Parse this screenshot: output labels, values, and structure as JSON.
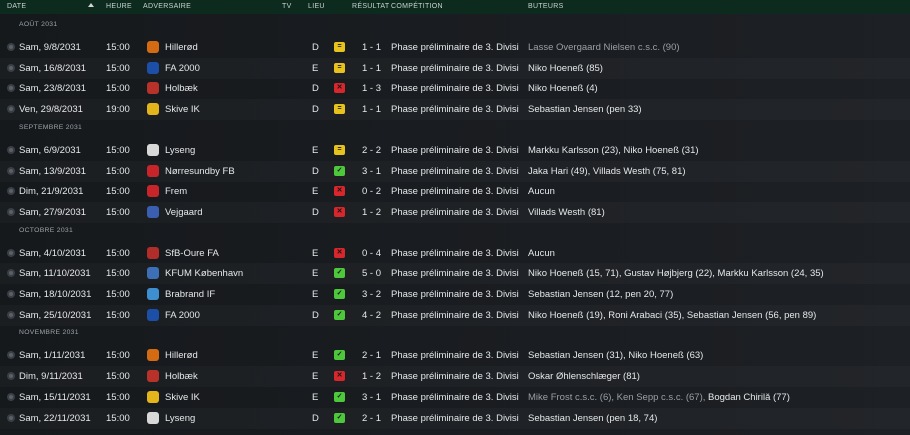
{
  "header": {
    "date": "DATE",
    "time": "HEURE",
    "opponent": "ADVERSAIRE",
    "tv": "TV",
    "venue": "LIEU",
    "result": "RÉSULTAT",
    "competition": "COMPÉTITION",
    "scorers": "BUTEURS"
  },
  "groups": [
    "AOÛT 2031",
    "SEPTEMBRE 2031",
    "OCTOBRE 2031",
    "NOVEMBRE 2031"
  ],
  "status_colors": {
    "draw": "#e8c21c",
    "loss": "#d7262c",
    "win": "#4cc83a"
  },
  "matches": [
    {
      "date": "Sam, 9/8/2031",
      "time": "15:00",
      "opponent": "Hillerød",
      "venue": "D",
      "result": "draw",
      "score": "1 - 1",
      "competition": "Phase préliminaire de 3. Divisi",
      "scorers_dim": "Lasse Overgaard Nielsen c.s.c. (90)",
      "scorers": ""
    },
    {
      "date": "Sam, 16/8/2031",
      "time": "15:00",
      "opponent": "FA 2000",
      "venue": "E",
      "result": "draw",
      "score": "1 - 1",
      "competition": "Phase préliminaire de 3. Divisi",
      "scorers_dim": "",
      "scorers": "Niko Hoeneß (85)"
    },
    {
      "date": "Sam, 23/8/2031",
      "time": "15:00",
      "opponent": "Holbæk",
      "venue": "D",
      "result": "loss",
      "score": "1 - 3",
      "competition": "Phase préliminaire de 3. Divisi",
      "scorers_dim": "",
      "scorers": "Niko Hoeneß (4)"
    },
    {
      "date": "Ven, 29/8/2031",
      "time": "19:00",
      "opponent": "Skive IK",
      "venue": "D",
      "result": "draw",
      "score": "1 - 1",
      "competition": "Phase préliminaire de 3. Divisi",
      "scorers_dim": "",
      "scorers": "Sebastian Jensen (pen 33)"
    },
    {
      "date": "Sam, 6/9/2031",
      "time": "15:00",
      "opponent": "Lyseng",
      "venue": "E",
      "result": "draw",
      "score": "2 - 2",
      "competition": "Phase préliminaire de 3. Divisi",
      "scorers_dim": "",
      "scorers": "Markku Karlsson (23), Niko Hoeneß (31)"
    },
    {
      "date": "Sam, 13/9/2031",
      "time": "15:00",
      "opponent": "Nørresundby FB",
      "venue": "D",
      "result": "win",
      "score": "3 - 1",
      "competition": "Phase préliminaire de 3. Divisi",
      "scorers_dim": "",
      "scorers": "Jaka Hari (49), Villads Westh (75, 81)"
    },
    {
      "date": "Dim, 21/9/2031",
      "time": "15:00",
      "opponent": "Frem",
      "venue": "E",
      "result": "loss",
      "score": "0 - 2",
      "competition": "Phase préliminaire de 3. Divisi",
      "scorers_dim": "",
      "scorers": "Aucun"
    },
    {
      "date": "Sam, 27/9/2031",
      "time": "15:00",
      "opponent": "Vejgaard",
      "venue": "D",
      "result": "loss",
      "score": "1 - 2",
      "competition": "Phase préliminaire de 3. Divisi",
      "scorers_dim": "",
      "scorers": "Villads Westh (81)"
    },
    {
      "date": "Sam, 4/10/2031",
      "time": "15:00",
      "opponent": "SfB-Oure FA",
      "venue": "E",
      "result": "loss",
      "score": "0 - 4",
      "competition": "Phase préliminaire de 3. Divisi",
      "scorers_dim": "",
      "scorers": "Aucun"
    },
    {
      "date": "Sam, 11/10/2031",
      "time": "15:00",
      "opponent": "KFUM København",
      "venue": "E",
      "result": "win",
      "score": "5 - 0",
      "competition": "Phase préliminaire de 3. Divisi",
      "scorers_dim": "",
      "scorers": "Niko Hoeneß (15, 71), Gustav Højbjerg (22), Markku Karlsson (24, 35)"
    },
    {
      "date": "Sam, 18/10/2031",
      "time": "15:00",
      "opponent": "Brabrand IF",
      "venue": "E",
      "result": "win",
      "score": "3 - 2",
      "competition": "Phase préliminaire de 3. Divisi",
      "scorers_dim": "",
      "scorers": "Sebastian Jensen (12, pen 20, 77)"
    },
    {
      "date": "Sam, 25/10/2031",
      "time": "15:00",
      "opponent": "FA 2000",
      "venue": "D",
      "result": "win",
      "score": "4 - 2",
      "competition": "Phase préliminaire de 3. Divisi",
      "scorers_dim": "",
      "scorers": "Niko Hoeneß (19), Roni Arabaci (35), Sebastian Jensen (56, pen 89)"
    },
    {
      "date": "Sam, 1/11/2031",
      "time": "15:00",
      "opponent": "Hillerød",
      "venue": "E",
      "result": "win",
      "score": "2 - 1",
      "competition": "Phase préliminaire de 3. Divisi",
      "scorers_dim": "",
      "scorers": "Sebastian Jensen (31), Niko Hoeneß (63)"
    },
    {
      "date": "Dim, 9/11/2031",
      "time": "15:00",
      "opponent": "Holbæk",
      "venue": "E",
      "result": "loss",
      "score": "1 - 2",
      "competition": "Phase préliminaire de 3. Divisi",
      "scorers_dim": "",
      "scorers": "Oskar Øhlenschlæger (81)"
    },
    {
      "date": "Sam, 15/11/2031",
      "time": "15:00",
      "opponent": "Skive IK",
      "venue": "E",
      "result": "win",
      "score": "3 - 1",
      "competition": "Phase préliminaire de 3. Divisi",
      "scorers_dim": "Mike Frost c.s.c. (6), Ken Sepp c.s.c. (67),",
      "scorers": "Bogdan Chirilă (77)"
    },
    {
      "date": "Sam, 22/11/2031",
      "time": "15:00",
      "opponent": "Lyseng",
      "venue": "D",
      "result": "win",
      "score": "2 - 1",
      "competition": "Phase préliminaire de 3. Divisi",
      "scorers_dim": "",
      "scorers": "Sebastian Jensen (pen 18, 74)"
    }
  ]
}
